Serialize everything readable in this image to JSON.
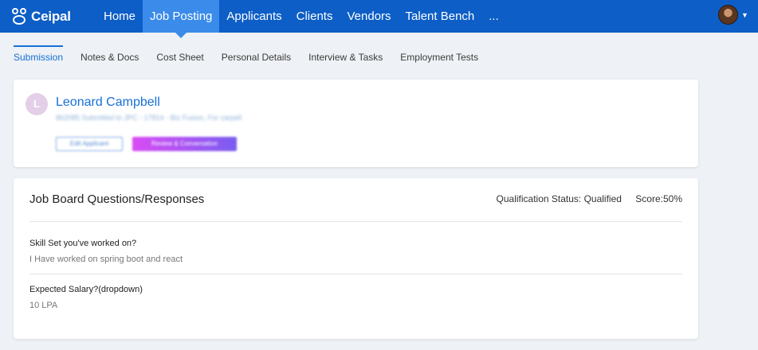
{
  "app": {
    "logo_text": "Ceipal"
  },
  "nav": {
    "items": [
      {
        "label": "Home"
      },
      {
        "label": "Job Posting"
      },
      {
        "label": "Applicants"
      },
      {
        "label": "Clients"
      },
      {
        "label": "Vendors"
      },
      {
        "label": "Talent Bench"
      },
      {
        "label": "..."
      }
    ],
    "active_index": 1
  },
  "subtabs": [
    {
      "label": "Submission"
    },
    {
      "label": "Notes & Docs"
    },
    {
      "label": "Cost Sheet"
    },
    {
      "label": "Personal Details"
    },
    {
      "label": "Interview & Tasks"
    },
    {
      "label": "Employment Tests"
    }
  ],
  "candidate": {
    "initial": "L",
    "name": "Leonard Campbell",
    "subtitle": "862085 Submitted to JPC - 17814 - Biz Fusion, For carpell",
    "edit_button": "Edit Applicant",
    "review_button": "Review & Conversation"
  },
  "job_board": {
    "title": "Job Board Questions/Responses",
    "qualification_status": "Qualification Status: Qualified",
    "score": "Score:50%",
    "questions": [
      {
        "question": "Skill Set you've worked on?",
        "answer": "I Have worked on spring boot and react"
      },
      {
        "question": "Expected Salary?(dropdown)",
        "answer": "10 LPA"
      }
    ]
  },
  "colors": {
    "nav_bg": "#0d5ec6",
    "nav_active": "#3a8bea",
    "link_blue": "#1670d8",
    "page_bg": "#eef1f5"
  }
}
